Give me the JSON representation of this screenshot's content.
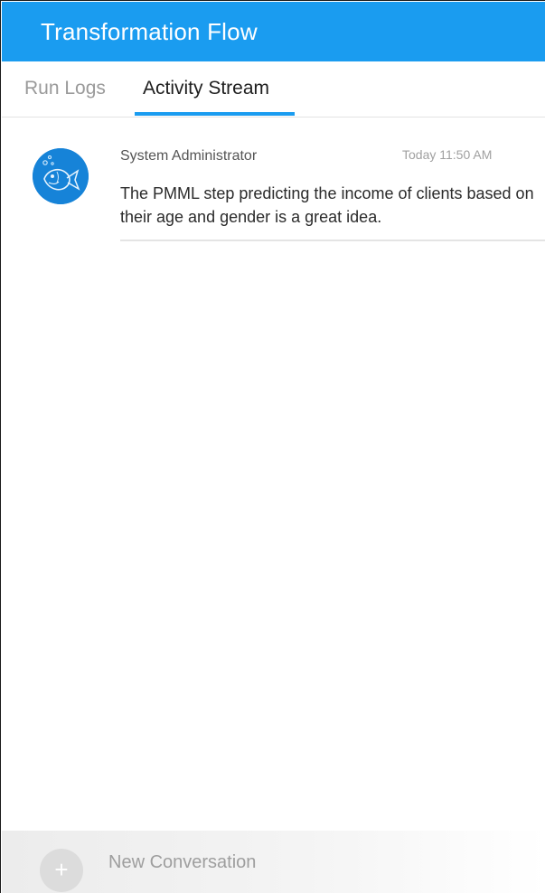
{
  "window": {
    "title": "Transformation Flow"
  },
  "tabs": [
    {
      "label": "Run Logs",
      "active": false
    },
    {
      "label": "Activity Stream",
      "active": true
    }
  ],
  "activity": {
    "entries": [
      {
        "author": "System Administrator",
        "time": "Today 11:50 AM",
        "message": "The PMML step predicting the income of clients based on their age and gender is a great idea.",
        "avatar_icon": "fish-avatar-icon"
      }
    ]
  },
  "footer": {
    "add_icon": "plus-icon",
    "new_conversation_label": "New Conversation"
  },
  "colors": {
    "accent": "#1a9cf0",
    "avatar": "#1683d8",
    "active_tab_text": "#1e1e1e",
    "inactive_tab_text": "#9a9a9a"
  }
}
